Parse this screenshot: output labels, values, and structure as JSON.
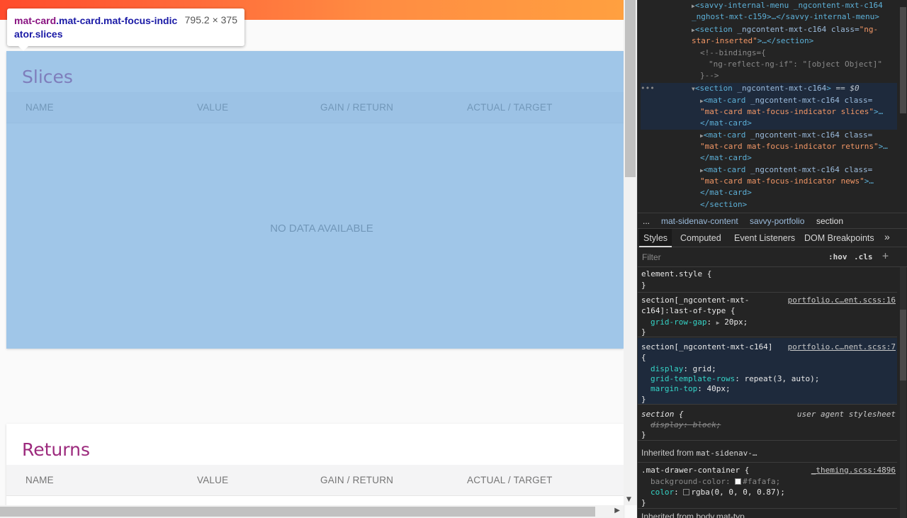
{
  "tooltip": {
    "tag": "mat-card",
    "classes": ".mat-card.mat-focus-indicator.slices",
    "size": "795.2 × 375"
  },
  "slices_card": {
    "title": "Slices",
    "columns": [
      "NAME",
      "VALUE",
      "GAIN / RETURN",
      "ACTUAL / TARGET"
    ],
    "empty_text": "NO DATA AVAILABLE"
  },
  "returns_card": {
    "title": "Returns",
    "columns": [
      "NAME",
      "VALUE",
      "GAIN / RETURN",
      "ACTUAL / TARGET"
    ]
  },
  "dom": {
    "l1a": "<savvy-internal-menu _ngcontent-mxt-c164",
    "l1b": "_nghost-mxt-c159>…</savvy-internal-menu>",
    "l2a_tag": "<section",
    "l2a_attr": " _ngcontent-mxt-c164 class=",
    "l2a_val": "\"ng-",
    "l2b_val": "star-inserted\"",
    "l2b_rest": ">…</section>",
    "l3a": "<!--bindings={",
    "l3b": "\"ng-reflect-ng-if\": \"[object Object]\"",
    "l3c": "}-->",
    "sel_ellipsis": "•••",
    "sel_tag": "<section",
    "sel_attr": " _ngcontent-mxt-c164",
    "sel_close": ">",
    "sel_marker": " == $0",
    "card1a_tag": "<mat-card",
    "card1a_attr": " _ngcontent-mxt-c164 class=",
    "card1b_val": "\"mat-card mat-focus-indicator slices\"",
    "card1b_rest": ">…",
    "card1c": "</mat-card>",
    "card2a_tag": "<mat-card",
    "card2a_attr": " _ngcontent-mxt-c164 class=",
    "card2b_val": "\"mat-card mat-focus-indicator returns\"",
    "card2b_rest": ">…",
    "card2c": "</mat-card>",
    "card3a_tag": "<mat-card",
    "card3a_attr": " _ngcontent-mxt-c164 class=",
    "card3b_val": "\"mat-card mat-focus-indicator news\"",
    "card3b_rest": ">…",
    "card3c": "</mat-card>",
    "end_section": "</section>"
  },
  "breadcrumbs": [
    "...",
    "mat-sidenav-content",
    "savvy-portfolio",
    "section"
  ],
  "panel_tabs": [
    "Styles",
    "Computed",
    "Event Listeners",
    "DOM Breakpoints",
    "»"
  ],
  "filter": {
    "placeholder": "Filter",
    "hov": ":hov",
    "cls": ".cls",
    "plus": "+"
  },
  "styles": {
    "r1_sel": "element.style {",
    "r1_end": "}",
    "r2_sel_a": "section[_ngcontent-mxt-",
    "r2_sel_b": "c164]:last-of-type {",
    "r2_src": "portfolio.c…ent.scss:16",
    "r2_prop": "grid-row-gap",
    "r2_val": "20px;",
    "r2_end": "}",
    "r3_sel": "section[_ngcontent-mxt-c164]",
    "r3_open": "{",
    "r3_src": "portfolio.c…nent.scss:7",
    "r3_p1": "display",
    "r3_v1": "grid;",
    "r3_p2": "grid-template-rows",
    "r3_v2": "repeat(3, auto);",
    "r3_p3": "margin-top",
    "r3_v3": "40px;",
    "r3_end": "}",
    "r4_sel": "section {",
    "r4_src": "user agent stylesheet",
    "r4_prop": "display: block;",
    "r4_end": "}",
    "inh1_label": "Inherited from",
    "inh1_from": "mat-sidenav-…",
    "r5_sel": ".mat-drawer-container {",
    "r5_src": "_theming.scss:4896",
    "r5_p1": "background-color",
    "r5_v1": "#fafafa;",
    "r5_p2": "color",
    "r5_v2": "rgba(0, 0, 0, 0.87);",
    "r5_end": "}",
    "inh2": "Inherited from body.mat-typ…"
  },
  "colors": {
    "title": "#9c2a7d",
    "highlight": "#6fa8dc",
    "swatch_bg": "#fafafa",
    "swatch_color": "#212121"
  }
}
